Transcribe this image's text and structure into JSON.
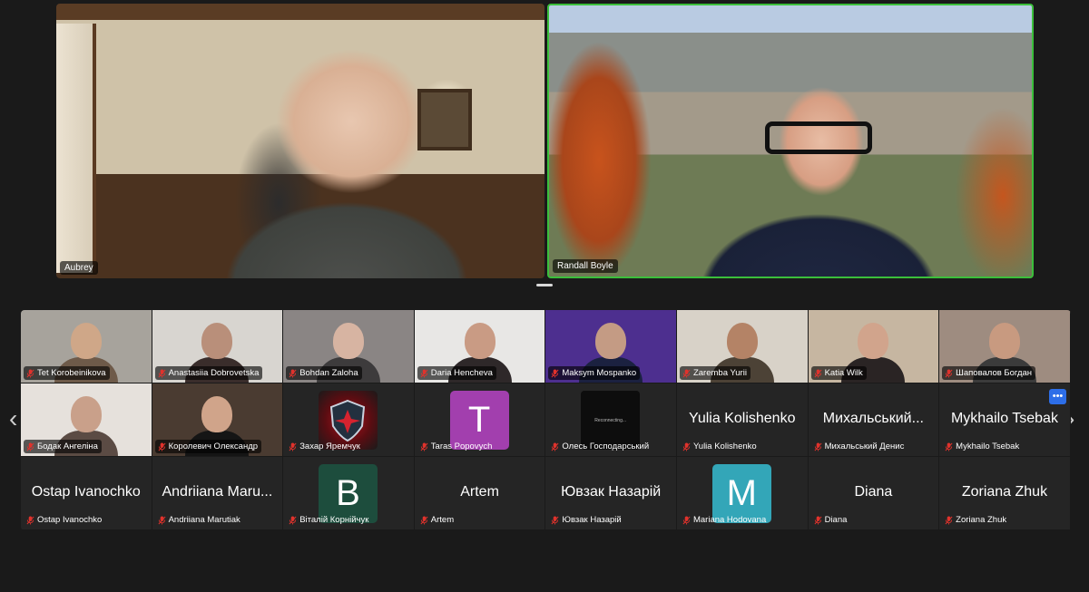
{
  "speakers": [
    {
      "name": "Aubrey"
    },
    {
      "name": "Randall Boyle"
    }
  ],
  "gallery": {
    "tiles": [
      {
        "kind": "video",
        "label": "Tet Korobeinikova",
        "bg": "#a7a39c",
        "face": "#cfa788",
        "body": "#6e5a49"
      },
      {
        "kind": "video",
        "label": "Anastasiia Dobrovetska",
        "bg": "#d8d5d0",
        "face": "#b98f7a",
        "body": "#3a2d2b"
      },
      {
        "kind": "video",
        "label": "Bohdan Zaloha",
        "bg": "#8a8584",
        "face": "#d7b4a2",
        "body": "#3d3b3c"
      },
      {
        "kind": "video",
        "label": "Daria Hencheva",
        "bg": "#e8e7e5",
        "face": "#c99b84",
        "body": "#2e2829"
      },
      {
        "kind": "video",
        "label": "Maksym Mospanko",
        "bg": "#4d2f8f",
        "face": "#c49b84",
        "body": "#1b2140"
      },
      {
        "kind": "video",
        "label": "Zaremba Yurii",
        "bg": "#d8d2c8",
        "face": "#b48366",
        "body": "#4c4236"
      },
      {
        "kind": "video",
        "label": "Katia Wilk",
        "bg": "#c6b6a1",
        "face": "#d1a48c",
        "body": "#2a2424"
      },
      {
        "kind": "video",
        "label": "Шаповалов Богдан",
        "bg": "#9e8c80",
        "face": "#c89a80",
        "body": "#3b3b3b"
      },
      {
        "kind": "video",
        "label": "Бодак Ангеліна",
        "bg": "#e6e1dc",
        "face": "#c9a08a",
        "body": "#5b4b44"
      },
      {
        "kind": "video",
        "label": "Королевич Олександр",
        "bg": "#4a3b31",
        "face": "#d0a48a",
        "body": "#151515"
      },
      {
        "kind": "avatar-img",
        "label": "Захар Яремчук"
      },
      {
        "kind": "avatar",
        "label": "Taras Popovych",
        "letter": "T",
        "color": "#a23fae"
      },
      {
        "kind": "reconnecting",
        "label": "Олесь Господарський",
        "status": "Reconnecting..."
      },
      {
        "kind": "text",
        "label": "Yulia Kolishenko",
        "display": "Yulia Kolishenko"
      },
      {
        "kind": "text",
        "label": "Михальський Денис",
        "display": "Михальський..."
      },
      {
        "kind": "text",
        "label": "Mykhailo Tsebak",
        "display": "Mykhailo Tsebak"
      },
      {
        "kind": "text",
        "label": "Ostap Ivanochko",
        "display": "Ostap Ivanochko"
      },
      {
        "kind": "text",
        "label": "Andriiana Marutiak",
        "display": "Andriiana Maru..."
      },
      {
        "kind": "avatar",
        "label": "Віталій Корнійчук",
        "letter": "B",
        "color": "#1d4d3d"
      },
      {
        "kind": "text",
        "label": "Artem",
        "display": "Artem"
      },
      {
        "kind": "text",
        "label": "Ювзак Назарій",
        "display": "Ювзак Назарій"
      },
      {
        "kind": "avatar",
        "label": "Mariana Hodovana",
        "letter": "M",
        "color": "#33a6b8"
      },
      {
        "kind": "text",
        "label": "Diana",
        "display": "Diana"
      },
      {
        "kind": "text",
        "label": "Zoriana Zhuk",
        "display": "Zoriana Zhuk"
      }
    ]
  },
  "controls": {
    "more_label": "•••",
    "prev": "‹",
    "next": "›"
  },
  "colors": {
    "active_speaker_border": "#3bbf3b",
    "muted_mic": "#e0322c",
    "more_button": "#2d6ee8"
  }
}
